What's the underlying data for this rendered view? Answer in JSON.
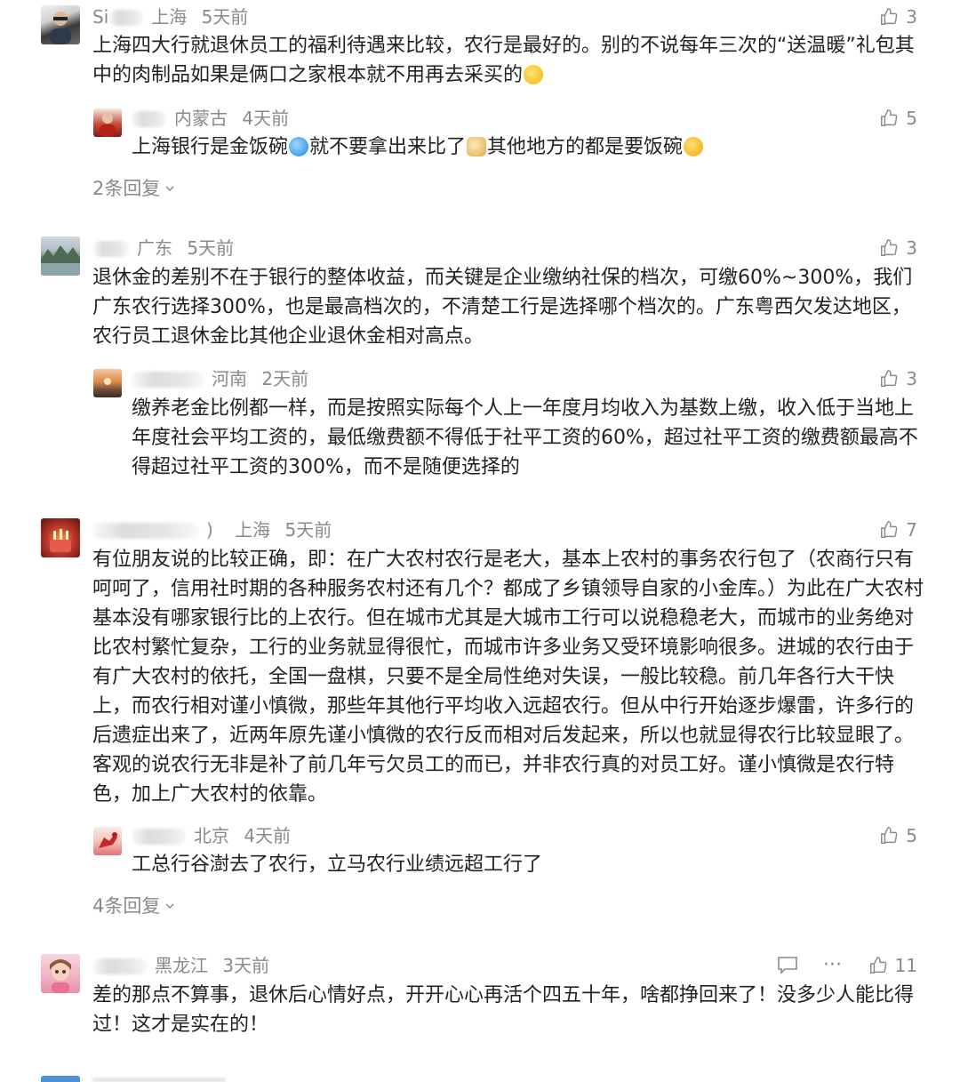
{
  "comments": [
    {
      "name_visible": "Si",
      "location": "上海",
      "time": "5天前",
      "likes": "3",
      "text_1": "上海四大行就退休员工的福利待遇来比较，农行是最好的。别的不说每年三次的“送温暖”礼包其中的肉制品如果是俩口之家根本就不用再去采买的",
      "emoji_1": "thinking-face-emoji",
      "reply": {
        "location": "内蒙古",
        "time": "4天前",
        "likes": "5",
        "text_1": "上海银行是金饭碗",
        "text_2": "就不要拿出来比了",
        "text_3": "其他地方的都是要饭碗",
        "emojis": [
          "blue-bowl-emoji",
          "doge-emoji",
          "crying-face-emoji"
        ]
      },
      "more_replies": "2条回复"
    },
    {
      "name_visible": "",
      "location": "广东",
      "time": "5天前",
      "likes": "3",
      "text_1": "退休金的差别不在于银行的整体收益，而关键是企业缴纳社保的档次，可缴60%~300%，我们广东农行选择300%，也是最高档次的，不清楚工行是选择哪个档次的。广东粤西欠发达地区，农行员工退休金比其他企业退休金相对高点。",
      "reply": {
        "location": "河南",
        "time": "2天前",
        "likes": "3",
        "text_1": "缴养老金比例都一样，而是按照实际每个人上一年度月均收入为基数上缴，收入低于当地上年度社会平均工资的，最低缴费额不得低于社平工资的60%，超过社平工资的缴费额最高不得超过社平工资的300%，而不是随便选择的"
      }
    },
    {
      "name_visible": ")",
      "location": "上海",
      "time": "5天前",
      "likes": "7",
      "text_1": "有位朋友说的比较正确，即：在广大农村农行是老大，基本上农村的事务农行包了（农商行只有呵呵了，信用社时期的各种服务农村还有几个？都成了乡镇领导自家的小金库。）为此在广大农村基本没有哪家银行比的上农行。但在城市尤其是大城市工行可以说稳稳老大，而城市的业务绝对比农村繁忙复杂，工行的业务就显得很忙，而城市许多业务又受环境影响很多。进城的农行由于有广大农村的依托，全国一盘棋，只要不是全局性绝对失误，一般比较稳。前几年各行大干快上，而农行相对谨小慎微，那些年其他行平均收入远超农行。但从中行开始逐步爆雷，许多行的后遗症出来了，近两年原先谨小慎微的农行反而相对后发起来，所以也就显得农行比较显眼了。客观的说农行无非是补了前几年亏欠员工的而已，并非农行真的对员工好。谨小慎微是农行特色，加上广大农村的依靠。",
      "reply": {
        "location": "北京",
        "time": "4天前",
        "likes": "5",
        "text_1": "工总行谷澍去了农行，立马农行业绩远超工行了"
      },
      "more_replies": "4条回复"
    },
    {
      "location": "黑龙江",
      "time": "3天前",
      "likes": "11",
      "text_1": "差的那点不算事，退休后心情好点，开开心心再活个四五十年，啥都挣回来了！没多少人能比得过！这才是实在的！",
      "more_icon": "···"
    }
  ],
  "colors": {
    "text": "#222222",
    "meta": "#8a8a8a",
    "background": "#ffffff"
  }
}
